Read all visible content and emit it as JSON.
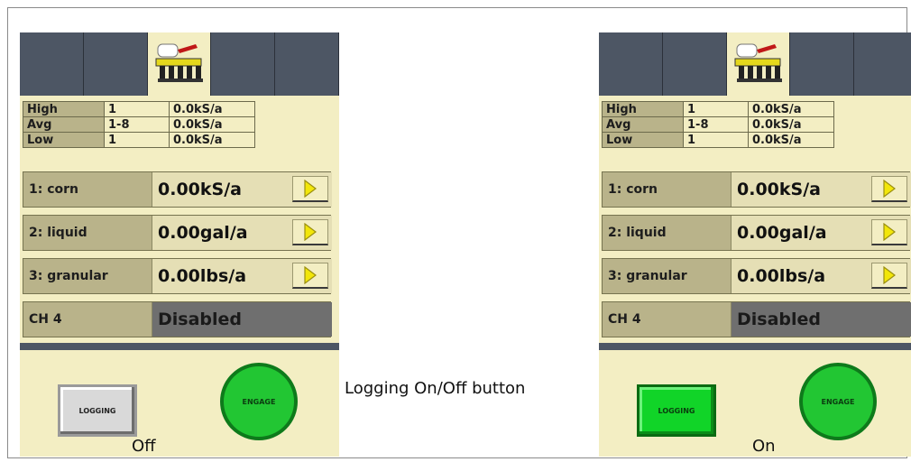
{
  "screens": [
    {
      "stats": [
        {
          "label": "High",
          "rows": "1",
          "rate": "0.0kS/a"
        },
        {
          "label": "Avg",
          "rows": "1-8",
          "rate": "0.0kS/a"
        },
        {
          "label": "Low",
          "rows": "1",
          "rate": "0.0kS/a"
        }
      ],
      "channels": [
        {
          "label": "1: corn",
          "rate": "0.00kS/a"
        },
        {
          "label": "2: liquid",
          "rate": "0.00gal/a"
        },
        {
          "label": "3: granular",
          "rate": "0.00lbs/a"
        },
        {
          "label": "CH 4",
          "rate": "Disabled"
        }
      ],
      "logging_label": "LOGGING",
      "engage_label": "ENGAGE",
      "state_caption": "Off"
    },
    {
      "stats": [
        {
          "label": "High",
          "rows": "1",
          "rate": "0.0kS/a"
        },
        {
          "label": "Avg",
          "rows": "1-8",
          "rate": "0.0kS/a"
        },
        {
          "label": "Low",
          "rows": "1",
          "rate": "0.0kS/a"
        }
      ],
      "channels": [
        {
          "label": "1: corn",
          "rate": "0.00kS/a"
        },
        {
          "label": "2: liquid",
          "rate": "0.00gal/a"
        },
        {
          "label": "3: granular",
          "rate": "0.00lbs/a"
        },
        {
          "label": "CH 4",
          "rate": "Disabled"
        }
      ],
      "logging_label": "LOGGING",
      "engage_label": "ENGAGE",
      "state_caption": "On"
    }
  ],
  "callout": "Logging On/Off button",
  "colors": {
    "panel_bg": "#f3eec3",
    "tab_bar": "#4d5664",
    "logging_on": "#11d428",
    "logging_off": "#d9d9d9",
    "engage": "#22c633",
    "arrow": "#f2e60a"
  },
  "icons": {
    "active_tab": "planter-icon",
    "rate_arrow": "play-arrow-icon"
  }
}
